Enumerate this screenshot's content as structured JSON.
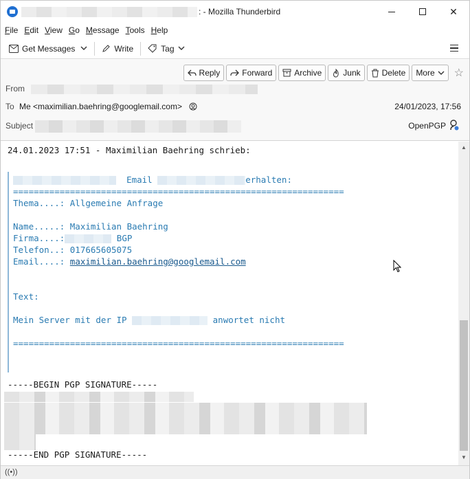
{
  "window": {
    "title_suffix": ": - Mozilla Thunderbird"
  },
  "menu": [
    {
      "key": "F",
      "rest": "ile"
    },
    {
      "key": "E",
      "rest": "dit"
    },
    {
      "key": "V",
      "rest": "iew"
    },
    {
      "key": "G",
      "rest": "o"
    },
    {
      "key": "M",
      "rest": "essage"
    },
    {
      "key": "T",
      "rest": "ools"
    },
    {
      "key": "H",
      "rest": "elp"
    }
  ],
  "toolbar": {
    "get_messages": "Get Messages",
    "write": "Write",
    "tag": "Tag"
  },
  "actions": {
    "reply": "Reply",
    "forward": "Forward",
    "archive": "Archive",
    "junk": "Junk",
    "delete": "Delete",
    "more": "More"
  },
  "header": {
    "from_label": "From",
    "to_label": "To",
    "to_value": "Me <maximilian.baehring@googlemail.com>",
    "subject_label": "Subject",
    "date": "24/01/2023, 17:56",
    "openpgp": "OpenPGP"
  },
  "message": {
    "intro": "24.01.2023 17:51 - Maximilian Baehring schrieb:",
    "email_word": "Email",
    "received": "erhalten:",
    "separator": "================================================================",
    "thema": "Thema....: Allgemeine Anfrage",
    "name": "Name.....: Maximilian Baehring",
    "firma_label": "Firma....:",
    "firma_value": "BGP",
    "telefon": "Telefon..: 017665605075",
    "email_label": "Email....:",
    "email_value": "maximilian.baehring@googlemail.com",
    "text_label": "Text:",
    "server_pre": "Mein Server mit der IP",
    "server_post": "anwortet nicht",
    "separator2": "================================================================",
    "pgp_begin": "-----BEGIN PGP SIGNATURE-----",
    "pgp_end": "-----END PGP SIGNATURE-----"
  }
}
